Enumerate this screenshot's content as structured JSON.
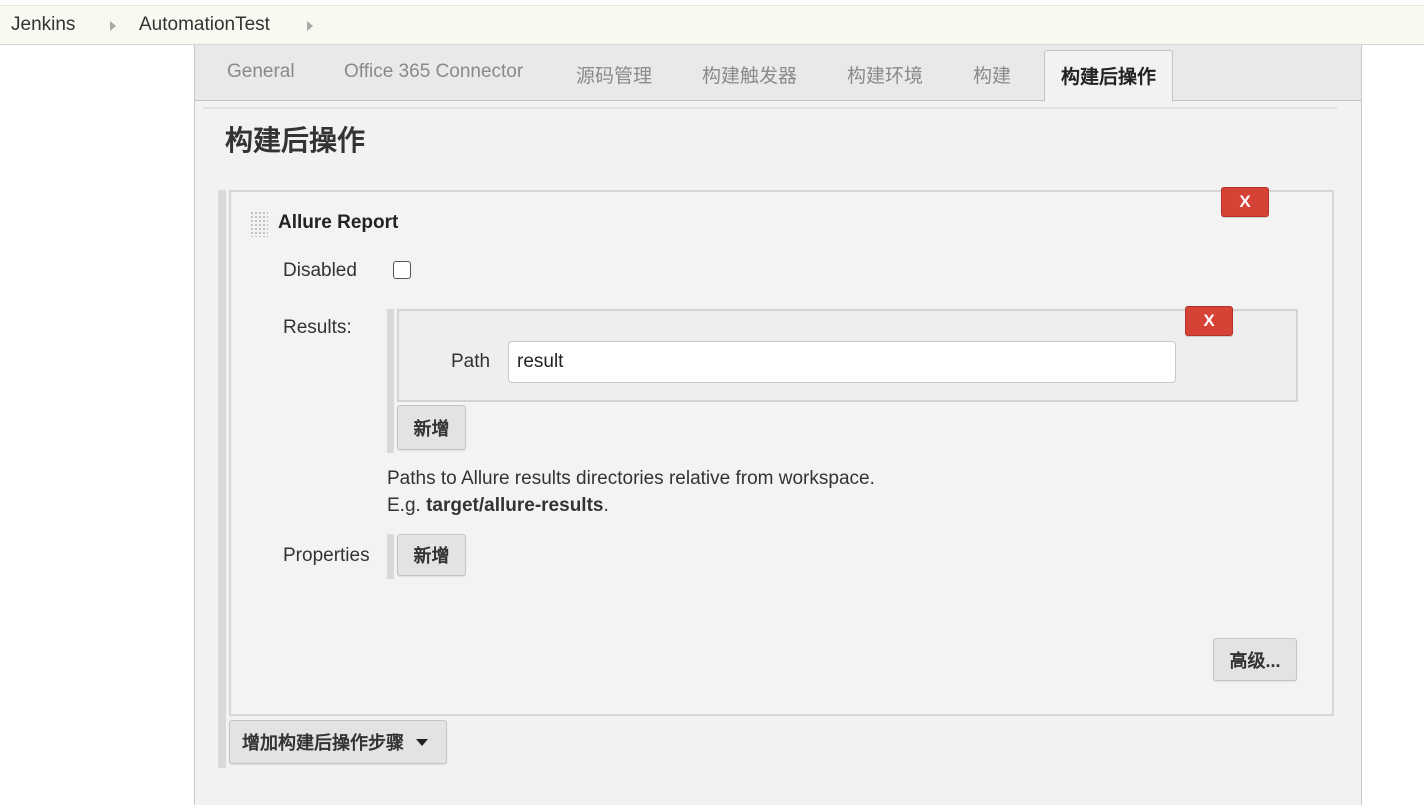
{
  "breadcrumb": {
    "items": [
      "Jenkins",
      "AutomationTest"
    ]
  },
  "tabs": [
    {
      "label": "General"
    },
    {
      "label": "Office 365 Connector"
    },
    {
      "label": "源码管理"
    },
    {
      "label": "构建触发器"
    },
    {
      "label": "构建环境"
    },
    {
      "label": "构建"
    },
    {
      "label": "构建后操作",
      "active": true
    }
  ],
  "section": {
    "title": "构建后操作"
  },
  "allure_step": {
    "title": "Allure Report",
    "delete_label": "X",
    "disabled_label": "Disabled",
    "disabled_checked": false,
    "results_label": "Results:",
    "results": [
      {
        "delete_label": "X",
        "path_label": "Path",
        "path_value": "result"
      }
    ],
    "add_results_label": "新增",
    "help_line1": "Paths to Allure results directories relative from workspace.",
    "help_prefix": "E.g. ",
    "help_example": "target/allure-results",
    "help_suffix": ".",
    "properties_label": "Properties",
    "add_properties_label": "新增",
    "advanced_label": "高级..."
  },
  "add_step_label": "增加构建后操作步骤",
  "colors": {
    "breadcrumb_bg": "#f8f9f1",
    "delete_red": "#d64236",
    "panel_bg": "#f2f2f2"
  }
}
